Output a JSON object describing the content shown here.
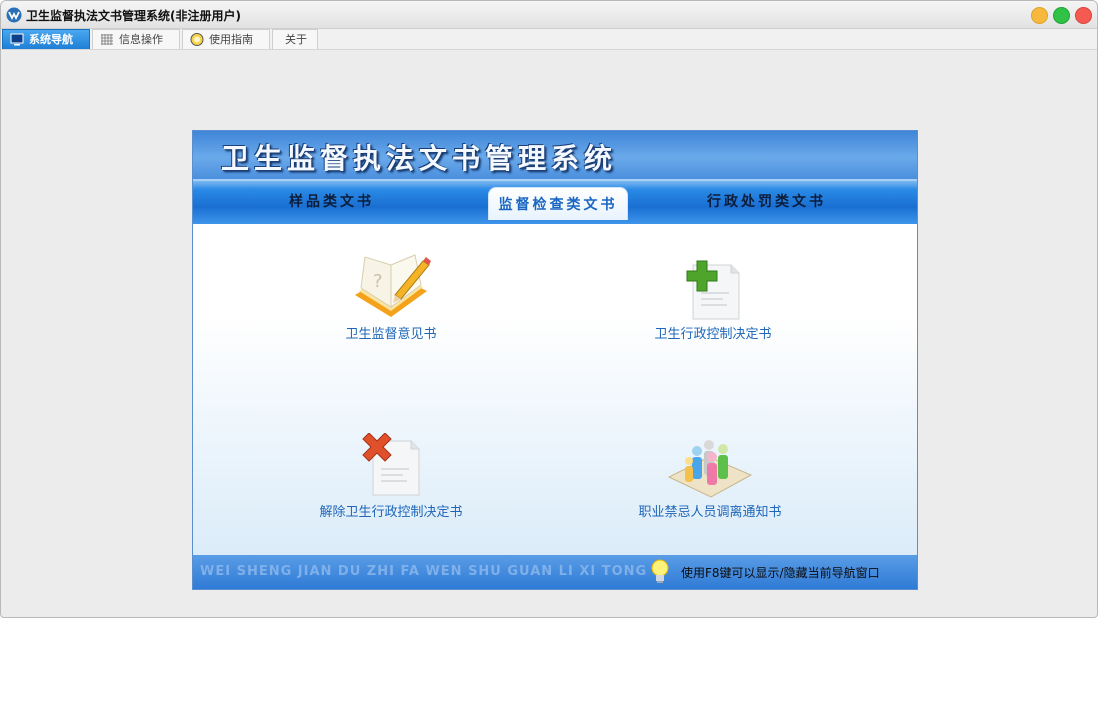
{
  "window": {
    "title": "卫生监督执法文书管理系统(非注册用户)"
  },
  "tabs": [
    {
      "label": "系统导航",
      "active": true
    },
    {
      "label": "信息操作",
      "active": false
    },
    {
      "label": "使用指南",
      "active": false
    },
    {
      "label": "关于",
      "active": false
    }
  ],
  "banner": {
    "title": "卫生监督执法文书管理系统"
  },
  "nav": {
    "tabs": [
      {
        "label": "样品类文书",
        "active": false
      },
      {
        "label": "监督检查类文书",
        "active": true
      },
      {
        "label": "行政处罚类文书",
        "active": false
      }
    ]
  },
  "documents": [
    {
      "label": "卫生监督意见书",
      "icon": "notebook-pencil-icon"
    },
    {
      "label": "卫生行政控制决定书",
      "icon": "document-add-icon"
    },
    {
      "label": "解除卫生行政控制决定书",
      "icon": "document-remove-icon"
    },
    {
      "label": "职业禁忌人员调离通知书",
      "icon": "people-group-icon"
    }
  ],
  "footer": {
    "pinyin": "WEI SHENG JIAN DU ZHI FA WEN SHU GUAN LI XI TONG",
    "tip": "使用F8键可以显示/隐藏当前导航窗口"
  },
  "colors": {
    "accent": "#1d7fd6",
    "banner": "#4b8fdd",
    "link": "#1f66b8"
  }
}
